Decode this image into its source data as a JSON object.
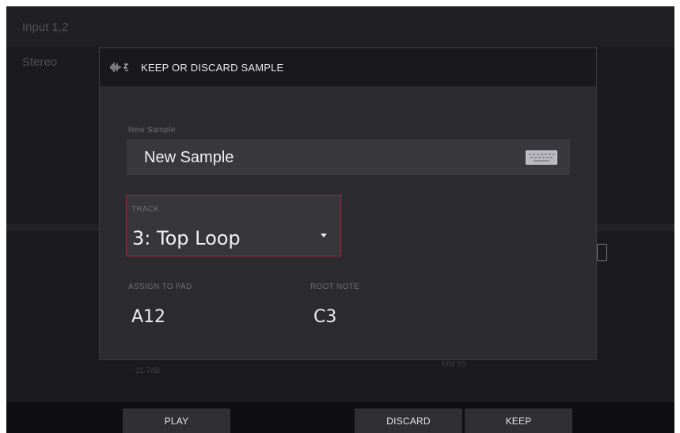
{
  "background": {
    "input_label": "Input 1,2",
    "mode_label": "Stereo",
    "level_readout": "-11.7dB",
    "meter_readout": "MM 55"
  },
  "dialog": {
    "title": "KEEP OR DISCARD SAMPLE",
    "name_label": "New Sample",
    "name_value": "New Sample",
    "track_label": "TRACK",
    "track_value": "3: Top Loop",
    "assign_label": "ASSIGN TO PAD",
    "assign_value": "A12",
    "root_label": "ROOT NOTE",
    "root_value": "C3"
  },
  "softkeys": {
    "play": "PLAY",
    "discard": "DISCARD",
    "keep": "KEEP"
  },
  "colors": {
    "accent_border": "#8c2f43",
    "modal_bg": "#2c2c30",
    "header_bg": "#19191c"
  },
  "icons": {
    "header": "waveform-edit-icon",
    "keyboard": "keyboard-icon",
    "dropdown": "caret-down-icon"
  }
}
